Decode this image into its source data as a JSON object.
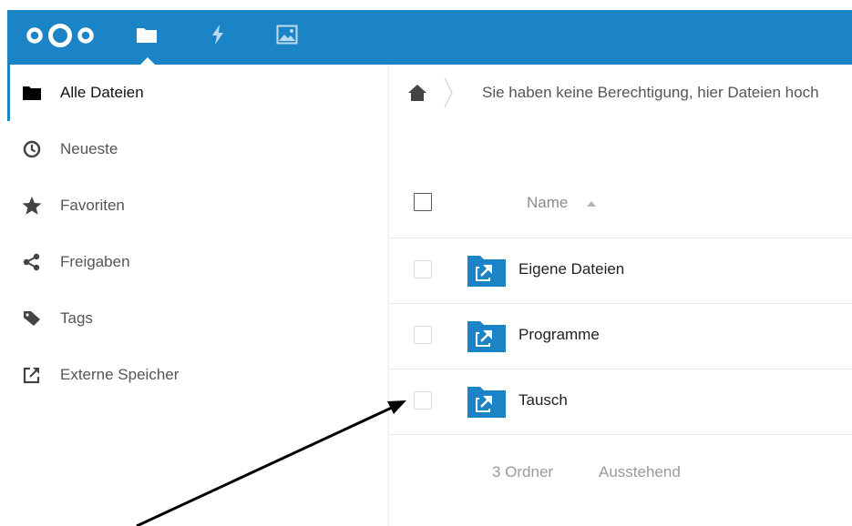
{
  "header": {
    "brand_color": "#1b84c7",
    "apps": [
      {
        "name": "files",
        "icon": "folder-icon",
        "active": true
      },
      {
        "name": "activity",
        "icon": "lightning-icon"
      },
      {
        "name": "gallery",
        "icon": "image-icon"
      }
    ]
  },
  "sidebar": {
    "items": [
      {
        "label": "Alle Dateien",
        "icon": "folder-icon",
        "active": true
      },
      {
        "label": "Neueste",
        "icon": "clock-icon"
      },
      {
        "label": "Favoriten",
        "icon": "star-icon"
      },
      {
        "label": "Freigaben",
        "icon": "share-icon"
      },
      {
        "label": "Tags",
        "icon": "tag-icon"
      },
      {
        "label": "Externe Speicher",
        "icon": "external-link-icon"
      }
    ]
  },
  "main": {
    "notice": "Sie haben keine Berechtigung, hier Dateien hoch",
    "table": {
      "column_name": "Name",
      "rows": [
        {
          "name": "Eigene Dateien",
          "icon": "shared-folder-icon"
        },
        {
          "name": "Programme",
          "icon": "shared-folder-icon"
        },
        {
          "name": "Tausch",
          "icon": "shared-folder-icon"
        }
      ]
    },
    "summary": {
      "count": "3 Ordner",
      "status": "Ausstehend"
    }
  }
}
